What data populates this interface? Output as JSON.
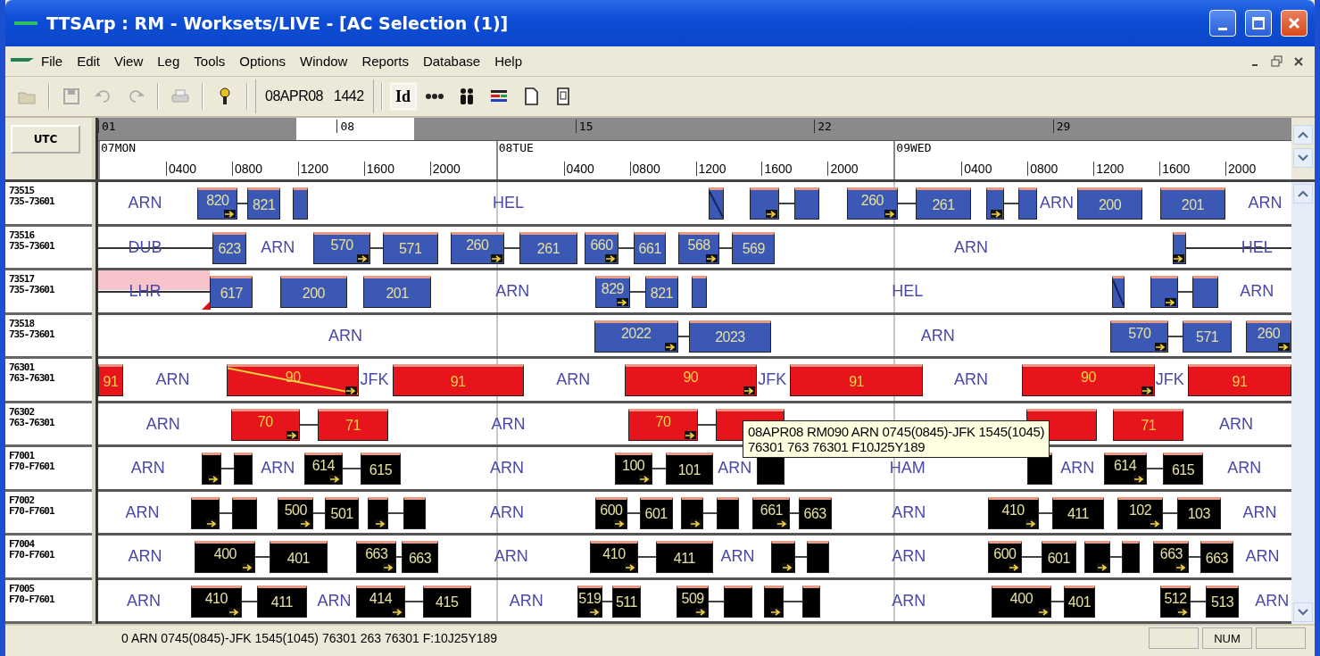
{
  "window": {
    "title": "TTSArp : RM - Worksets/LIVE - [AC Selection (1)]"
  },
  "menu": [
    "File",
    "Edit",
    "View",
    "Leg",
    "Tools",
    "Options",
    "Window",
    "Reports",
    "Database",
    "Help"
  ],
  "toolbar": {
    "buttons": [
      {
        "disabled": true
      },
      {
        "disabled": true
      },
      {
        "disabled": true
      },
      {
        "disabled": true
      },
      {
        "disabled": true
      },
      {
        "disabled": false
      }
    ],
    "date": "08APR08",
    "time": "1442",
    "id_button": "Id"
  },
  "header": {
    "zone_button": "UTC",
    "weeks": [
      {
        "label": "01",
        "selected": false
      },
      {
        "label": "08",
        "selected": true
      },
      {
        "label": "15",
        "selected": false
      },
      {
        "label": "22",
        "selected": false
      },
      {
        "label": "29",
        "selected": false
      }
    ],
    "days": [
      {
        "label": "07MON",
        "hours": [
          "0400",
          "0800",
          "1200",
          "1600",
          "2000"
        ]
      },
      {
        "label": "08TUE",
        "hours": [
          "0400",
          "0800",
          "1200",
          "1600",
          "2000"
        ]
      },
      {
        "label": "09WED",
        "hours": [
          "0400",
          "0800",
          "1200",
          "1600",
          "2000"
        ]
      }
    ]
  },
  "rows": [
    {
      "code": "73515",
      "range": "735-73601",
      "color": "#3a58b4",
      "items": [
        {
          "kind": "station",
          "label": "ARN"
        },
        {
          "kind": "leg",
          "label": "820",
          "arrow": true,
          "diagonal": false
        },
        {
          "kind": "leg",
          "label": "821",
          "arrow": false,
          "diagonal": false
        },
        {
          "kind": "leg",
          "arrow": false,
          "diagonal": false
        },
        {
          "kind": "station",
          "label": "HEL"
        },
        {
          "kind": "leg",
          "arrow": false,
          "diagonal": true
        },
        {
          "kind": "leg",
          "arrow": true,
          "diagonal": false
        },
        {
          "kind": "leg",
          "arrow": false,
          "diagonal": false
        },
        {
          "kind": "leg",
          "label": "260",
          "arrow": true,
          "diagonal": false
        },
        {
          "kind": "leg",
          "label": "261",
          "arrow": false,
          "diagonal": false
        },
        {
          "kind": "leg",
          "arrow": true,
          "diagonal": false
        },
        {
          "kind": "leg",
          "arrow": false,
          "diagonal": false
        },
        {
          "kind": "station",
          "label": "ARN"
        },
        {
          "kind": "leg",
          "label": "200",
          "arrow": false,
          "diagonal": false
        },
        {
          "kind": "leg",
          "label": "201",
          "arrow": false,
          "diagonal": false
        },
        {
          "kind": "station",
          "label": "ARN"
        }
      ]
    },
    {
      "code": "73516",
      "range": "735-73601",
      "color": "#3a58b4",
      "items": [
        {
          "kind": "line"
        },
        {
          "kind": "station",
          "label": "DUB"
        },
        {
          "kind": "leg",
          "label": "623",
          "arrow": false,
          "diagonal": false
        },
        {
          "kind": "station",
          "label": "ARN"
        },
        {
          "kind": "leg",
          "label": "570",
          "arrow": true,
          "diagonal": false
        },
        {
          "kind": "leg",
          "label": "571",
          "arrow": false,
          "diagonal": false
        },
        {
          "kind": "leg",
          "label": "260",
          "arrow": true,
          "diagonal": false
        },
        {
          "kind": "leg",
          "label": "261",
          "arrow": false,
          "diagonal": false
        },
        {
          "kind": "leg",
          "label": "660",
          "arrow": true,
          "diagonal": false
        },
        {
          "kind": "leg",
          "label": "661",
          "arrow": false,
          "diagonal": false
        },
        {
          "kind": "leg",
          "label": "568",
          "arrow": true,
          "diagonal": false
        },
        {
          "kind": "leg",
          "label": "569",
          "arrow": false,
          "diagonal": false
        },
        {
          "kind": "station",
          "label": "ARN"
        },
        {
          "kind": "leg",
          "arrow": true,
          "diagonal": false
        },
        {
          "kind": "line"
        },
        {
          "kind": "station",
          "label": "HEL"
        }
      ]
    },
    {
      "code": "73517",
      "range": "735-73601",
      "color": "#3a58b4",
      "items": [
        {
          "kind": "band"
        },
        {
          "kind": "line"
        },
        {
          "kind": "station",
          "label": "LHR"
        },
        {
          "kind": "leg",
          "label": "617",
          "arrow": false,
          "diagonal": false
        },
        {
          "kind": "leg",
          "label": "200",
          "arrow": false,
          "diagonal": false
        },
        {
          "kind": "leg",
          "label": "201",
          "arrow": false,
          "diagonal": false
        },
        {
          "kind": "station",
          "label": "ARN"
        },
        {
          "kind": "leg",
          "label": "829",
          "arrow": true,
          "diagonal": false
        },
        {
          "kind": "leg",
          "label": "821",
          "arrow": false,
          "diagonal": false
        },
        {
          "kind": "leg",
          "arrow": false,
          "diagonal": false
        },
        {
          "kind": "station",
          "label": "HEL"
        },
        {
          "kind": "leg",
          "arrow": false,
          "diagonal": true
        },
        {
          "kind": "leg",
          "arrow": true,
          "diagonal": false
        },
        {
          "kind": "leg",
          "arrow": false,
          "diagonal": false
        },
        {
          "kind": "station",
          "label": "ARN"
        }
      ]
    },
    {
      "code": "73518",
      "range": "735-73601",
      "color": "#3a58b4",
      "items": [
        {
          "kind": "station",
          "label": "ARN"
        },
        {
          "kind": "leg",
          "label": "2022",
          "arrow": true,
          "diagonal": false
        },
        {
          "kind": "leg",
          "label": "2023",
          "arrow": false,
          "diagonal": false
        },
        {
          "kind": "station",
          "label": "ARN"
        },
        {
          "kind": "leg",
          "label": "570",
          "arrow": true,
          "diagonal": false
        },
        {
          "kind": "leg",
          "label": "571",
          "arrow": false,
          "diagonal": false
        },
        {
          "kind": "leg",
          "label": "260",
          "arrow": true,
          "diagonal": false
        }
      ]
    },
    {
      "code": "76301",
      "range": "763-76301",
      "color": "#e8141c",
      "items": [
        {
          "kind": "leg",
          "label": "91",
          "arrow": false,
          "diagonal": false
        },
        {
          "kind": "station",
          "label": "ARN"
        },
        {
          "kind": "leg",
          "label": "90",
          "arrow": true,
          "diagonal": true
        },
        {
          "kind": "station",
          "label": "JFK"
        },
        {
          "kind": "leg",
          "label": "91",
          "arrow": false,
          "diagonal": false
        },
        {
          "kind": "station",
          "label": "ARN"
        },
        {
          "kind": "leg",
          "label": "90",
          "arrow": true,
          "diagonal": false
        },
        {
          "kind": "station",
          "label": "JFK"
        },
        {
          "kind": "leg",
          "label": "91",
          "arrow": false,
          "diagonal": false
        },
        {
          "kind": "station",
          "label": "ARN"
        },
        {
          "kind": "leg",
          "label": "90",
          "arrow": true,
          "diagonal": false
        },
        {
          "kind": "station",
          "label": "JFK"
        },
        {
          "kind": "leg",
          "label": "91",
          "arrow": false,
          "diagonal": false
        }
      ]
    },
    {
      "code": "76302",
      "range": "763-76301",
      "color": "#e8141c",
      "items": [
        {
          "kind": "station",
          "label": "ARN"
        },
        {
          "kind": "leg",
          "label": "70",
          "arrow": true,
          "diagonal": false
        },
        {
          "kind": "leg",
          "label": "71",
          "arrow": false,
          "diagonal": false
        },
        {
          "kind": "station",
          "label": "ARN"
        },
        {
          "kind": "leg",
          "label": "70",
          "arrow": true,
          "diagonal": false
        },
        {
          "kind": "leg"
        },
        {
          "kind": "leg"
        },
        {
          "kind": "leg",
          "label": "71",
          "arrow": false,
          "diagonal": false
        },
        {
          "kind": "station",
          "label": "ARN"
        }
      ]
    },
    {
      "code": "F7001",
      "range": "F70-F7601",
      "color": "#000000",
      "items": [
        {
          "kind": "station",
          "label": "ARN"
        },
        {
          "kind": "leg",
          "arrow": true,
          "diagonal": false
        },
        {
          "kind": "leg",
          "arrow": false,
          "diagonal": false
        },
        {
          "kind": "station",
          "label": "ARN"
        },
        {
          "kind": "leg",
          "label": "614",
          "arrow": true,
          "diagonal": false
        },
        {
          "kind": "leg",
          "label": "615",
          "arrow": false,
          "diagonal": false
        },
        {
          "kind": "station",
          "label": "ARN"
        },
        {
          "kind": "leg",
          "label": "100",
          "arrow": true,
          "diagonal": false
        },
        {
          "kind": "leg",
          "label": "101",
          "arrow": false,
          "diagonal": false
        },
        {
          "kind": "station",
          "label": "ARN"
        },
        {
          "kind": "leg",
          "arrow": false,
          "diagonal": false
        },
        {
          "kind": "station",
          "label": "HAM"
        },
        {
          "kind": "leg",
          "arrow": false,
          "diagonal": false
        },
        {
          "kind": "station",
          "label": "ARN"
        },
        {
          "kind": "leg",
          "label": "614",
          "arrow": true,
          "diagonal": false
        },
        {
          "kind": "leg",
          "label": "615",
          "arrow": false,
          "diagonal": false
        },
        {
          "kind": "station",
          "label": "ARN"
        }
      ]
    },
    {
      "code": "F7002",
      "range": "F70-F7601",
      "color": "#000000",
      "items": [
        {
          "kind": "station",
          "label": "ARN"
        },
        {
          "kind": "leg",
          "arrow": true,
          "diagonal": false
        },
        {
          "kind": "leg",
          "arrow": false,
          "diagonal": false
        },
        {
          "kind": "leg",
          "label": "500",
          "arrow": true,
          "diagonal": false
        },
        {
          "kind": "leg",
          "label": "501",
          "arrow": false,
          "diagonal": false
        },
        {
          "kind": "leg",
          "arrow": true,
          "diagonal": false
        },
        {
          "kind": "leg",
          "arrow": false,
          "diagonal": false
        },
        {
          "kind": "station",
          "label": "ARN"
        },
        {
          "kind": "leg",
          "label": "600",
          "arrow": true,
          "diagonal": false
        },
        {
          "kind": "leg",
          "label": "601",
          "arrow": false,
          "diagonal": false
        },
        {
          "kind": "leg",
          "arrow": true,
          "diagonal": false
        },
        {
          "kind": "leg",
          "arrow": false,
          "diagonal": false
        },
        {
          "kind": "leg",
          "label": "661",
          "arrow": true,
          "diagonal": false
        },
        {
          "kind": "leg",
          "label": "663",
          "arrow": false,
          "diagonal": false
        },
        {
          "kind": "station",
          "label": "ARN"
        },
        {
          "kind": "leg",
          "label": "410",
          "arrow": true,
          "diagonal": false
        },
        {
          "kind": "leg",
          "label": "411",
          "arrow": false,
          "diagonal": false
        },
        {
          "kind": "leg",
          "label": "102",
          "arrow": true,
          "diagonal": false
        },
        {
          "kind": "leg",
          "label": "103",
          "arrow": false,
          "diagonal": false
        },
        {
          "kind": "station",
          "label": "ARN"
        }
      ]
    },
    {
      "code": "F7004",
      "range": "F70-F7601",
      "color": "#000000",
      "items": [
        {
          "kind": "station",
          "label": "ARN"
        },
        {
          "kind": "leg",
          "label": "400",
          "arrow": true,
          "diagonal": false
        },
        {
          "kind": "leg",
          "label": "401",
          "arrow": false,
          "diagonal": false
        },
        {
          "kind": "leg",
          "label": "663",
          "arrow": true,
          "diagonal": false
        },
        {
          "kind": "leg",
          "label": "663",
          "arrow": false,
          "diagonal": false
        },
        {
          "kind": "station",
          "label": "ARN"
        },
        {
          "kind": "leg",
          "label": "410",
          "arrow": true,
          "diagonal": false
        },
        {
          "kind": "leg",
          "label": "411",
          "arrow": false,
          "diagonal": false
        },
        {
          "kind": "station",
          "label": "ARN"
        },
        {
          "kind": "leg",
          "arrow": true,
          "diagonal": false
        },
        {
          "kind": "leg",
          "arrow": false,
          "diagonal": false
        },
        {
          "kind": "station",
          "label": "ARN"
        },
        {
          "kind": "leg",
          "label": "600",
          "arrow": true,
          "diagonal": false
        },
        {
          "kind": "leg",
          "label": "601",
          "arrow": false,
          "diagonal": false
        },
        {
          "kind": "leg",
          "arrow": true,
          "diagonal": false
        },
        {
          "kind": "leg",
          "arrow": false,
          "diagonal": false
        },
        {
          "kind": "leg",
          "label": "663",
          "arrow": true,
          "diagonal": false
        },
        {
          "kind": "leg",
          "label": "663",
          "arrow": false,
          "diagonal": false
        },
        {
          "kind": "station",
          "label": "ARN"
        }
      ]
    },
    {
      "code": "F7005",
      "range": "F70-F7601",
      "color": "#000000",
      "items": [
        {
          "kind": "station",
          "label": "ARN"
        },
        {
          "kind": "leg",
          "label": "410",
          "arrow": true,
          "diagonal": false
        },
        {
          "kind": "leg",
          "label": "411",
          "arrow": false,
          "diagonal": false
        },
        {
          "kind": "station",
          "label": "ARN"
        },
        {
          "kind": "leg",
          "label": "414",
          "arrow": true,
          "diagonal": false
        },
        {
          "kind": "leg",
          "label": "415",
          "arrow": false,
          "diagonal": false
        },
        {
          "kind": "station",
          "label": "ARN"
        },
        {
          "kind": "leg",
          "label": "519",
          "arrow": true,
          "diagonal": false
        },
        {
          "kind": "leg",
          "label": "511",
          "arrow": false,
          "diagonal": false
        },
        {
          "kind": "leg",
          "label": "509",
          "arrow": true,
          "diagonal": false
        },
        {
          "kind": "leg",
          "arrow": false,
          "diagonal": false
        },
        {
          "kind": "leg",
          "arrow": true,
          "diagonal": false
        },
        {
          "kind": "leg",
          "arrow": false,
          "diagonal": false
        },
        {
          "kind": "station",
          "label": "ARN"
        },
        {
          "kind": "leg",
          "label": "400",
          "arrow": true,
          "diagonal": false
        },
        {
          "kind": "leg",
          "label": "401",
          "arrow": false,
          "diagonal": false
        },
        {
          "kind": "leg",
          "label": "512",
          "arrow": true,
          "diagonal": false
        },
        {
          "kind": "leg",
          "label": "513",
          "arrow": false,
          "diagonal": false
        },
        {
          "kind": "station",
          "label": "ARN"
        }
      ]
    }
  ],
  "tooltip": {
    "lines": [
      "08APR08 RM090 ARN 0745(0845)-JFK 1545(1045)",
      "76301 763 76301 F10J25Y189"
    ]
  },
  "status_bar": {
    "text": "0 ARN 0745(0845)-JFK 1545(1045)  76301 263 76301 F:10J25Y189",
    "indicator": "NUM"
  }
}
